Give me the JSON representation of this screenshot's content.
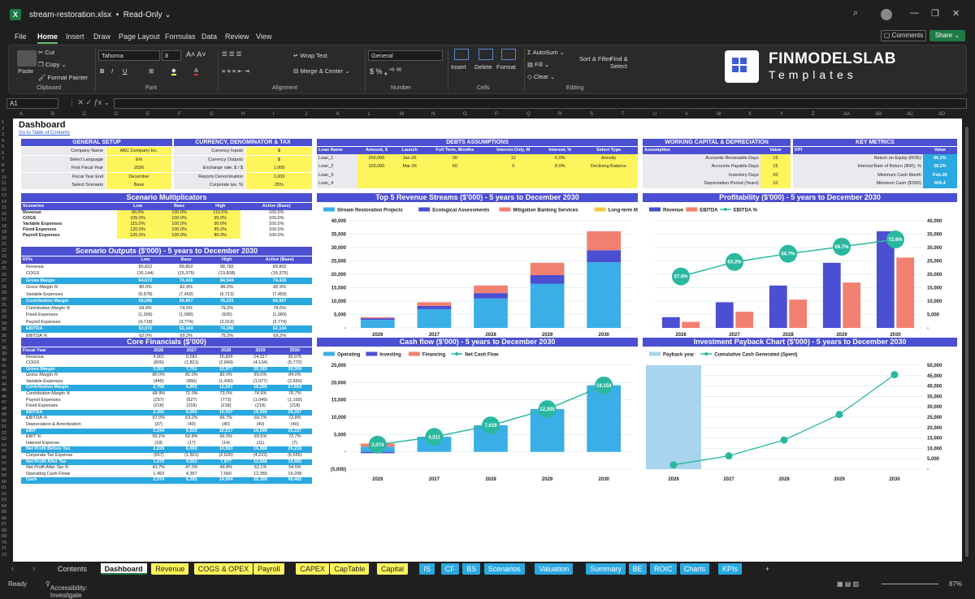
{
  "window": {
    "file": "stream-restoration.xlsx",
    "mode": "Read-Only"
  },
  "menu": [
    "File",
    "Home",
    "Insert",
    "Draw",
    "Page Layout",
    "Formulas",
    "Data",
    "Review",
    "View"
  ],
  "buttons": {
    "comments": "Comments",
    "share": "Share"
  },
  "ribbon": {
    "paste": "Paste",
    "cut": "Cut",
    "copy": "Copy",
    "format_painter": "Format Painter",
    "clipboard": "Clipboard",
    "font_name": "Tahoma",
    "font_size": "8",
    "font": "Font",
    "wrap": "Wrap Text",
    "merge": "Merge & Center",
    "alignment": "Alignment",
    "number_format": "General",
    "number": "Number",
    "insert": "Insert",
    "delete": "Delete",
    "format": "Format",
    "cells": "Cells",
    "autosum": "AutoSum",
    "fill": "Fill",
    "clear": "Clear",
    "sort": "Sort & Filter",
    "find": "Find & Select",
    "editing": "Editing"
  },
  "brand": {
    "line1": "FINMODELSLAB",
    "line2": "Templates"
  },
  "namebox": "A1",
  "sheet": {
    "title": "Dashboard",
    "link": "Go to Table of Contents"
  },
  "general": {
    "title": "GENERAL SETUP",
    "rows": [
      [
        "Company Name",
        "ABC Company Inc."
      ],
      [
        "Select Language",
        "EN"
      ],
      [
        "First Fiscal Year",
        "2026"
      ],
      [
        "Fiscal Year End",
        "December"
      ],
      [
        "Select Scenario",
        "Base"
      ]
    ]
  },
  "currency": {
    "title": "CURRENCY, DENOMINATOR & TAX",
    "rows": [
      [
        "Currency Inputs",
        "$"
      ],
      [
        "Currency Outputs",
        "$"
      ],
      [
        "Exchange rate, $ / $",
        "1.000"
      ],
      [
        "Reports Denomination",
        "1,000"
      ],
      [
        "Corporate tax, %",
        "25%"
      ]
    ]
  },
  "debts": {
    "title": "DEBTS ASSUMPTIONS",
    "headers": [
      "Loan Name",
      "Amount, $",
      "Launch",
      "Full Term, Months",
      "Interest-Only, M",
      "Interest, %",
      "Select Type"
    ],
    "rows": [
      [
        "Loan_1",
        "200,000",
        "Jan-26",
        "90",
        "12",
        "6.0%",
        "Annuity"
      ],
      [
        "Loan_2",
        "100,000",
        "Mar-26",
        "60",
        "0",
        "8.0%",
        "Declining Balance"
      ],
      [
        "Loan_3",
        "",
        "",
        "",
        "",
        "",
        ""
      ],
      [
        "Loan_4",
        "",
        "",
        "",
        "",
        "",
        ""
      ]
    ]
  },
  "wc": {
    "title": "WORKING CAPITAL & DEPRECIATION",
    "headers": [
      "Assumption",
      "Value"
    ],
    "rows": [
      [
        "Accounts Receivable Days",
        "15"
      ],
      [
        "Accounts Payable Days",
        "15"
      ],
      [
        "Inventory Days",
        "20"
      ],
      [
        "Depreciation Period (Years)",
        "10"
      ]
    ]
  },
  "kpi": {
    "title": "KEY METRICS",
    "headers": [
      "KPI",
      "Value"
    ],
    "rows": [
      [
        "Return on Equity (ROE)",
        "66.2%"
      ],
      [
        "Internal Rate of Return (IRR), %",
        "28.2%"
      ],
      [
        "Minimum Cash Month",
        "Feb-26"
      ],
      [
        "Minimum Cash ($'000)",
        "609.4"
      ]
    ]
  },
  "multipliers": {
    "title": "Scenario Multiplicators",
    "headers": [
      "Scenarios",
      "Low",
      "Base",
      "High",
      "Active (Base)"
    ],
    "rows": [
      [
        "Revenue",
        "90.0%",
        "100.0%",
        "110.0%",
        "100.0%"
      ],
      [
        "COGS",
        "105.0%",
        "100.0%",
        "95.0%",
        "100.0%"
      ],
      [
        "Variable Expenses",
        "115.0%",
        "100.0%",
        "90.0%",
        "100.0%"
      ],
      [
        "Fixed Expenses",
        "120.0%",
        "100.0%",
        "85.0%",
        "100.0%"
      ],
      [
        "Payroll Expenses",
        "125.0%",
        "100.0%",
        "80.0%",
        "100.0%"
      ]
    ]
  },
  "outputs": {
    "title": "Scenario Outputs ($'000) - 5 years to December 2030",
    "headers": [
      "KPIs",
      "Low",
      "Base",
      "High",
      "Active (Base)"
    ],
    "rows": [
      [
        "Revenue",
        "80,822",
        "89,802",
        "98,782",
        "89,802",
        ""
      ],
      [
        "COGS",
        "(16,144)",
        "(15,375)",
        "(13,838)",
        "(15,375)",
        ""
      ],
      [
        "Gross Margin",
        "64,672",
        "74,426",
        "84,944",
        "74,426",
        "hl"
      ],
      [
        "Gross Margin %",
        "80.0%",
        "82.9%",
        "86.0%",
        "82.9%",
        "it"
      ],
      [
        "Variable Expenses",
        "(9,578)",
        "(7,459)",
        "(6,713)",
        "(7,459)",
        ""
      ],
      [
        "Contribution Margin",
        "56,096",
        "66,967",
        "78,231",
        "66,967",
        "hl"
      ],
      [
        "Contribution Margin %",
        "69.4%",
        "74.6%",
        "79.2%",
        "74.6%",
        "it"
      ],
      [
        "Fixed Expenses",
        "(1,306)",
        "(1,089)",
        "(926)",
        "(1,089)",
        ""
      ],
      [
        "Payroll Expenses",
        "(4,718)",
        "(3,774)",
        "(3,019)",
        "(3,774)",
        ""
      ],
      [
        "EBITDA",
        "50,072",
        "62,104",
        "74,286",
        "62,104",
        "hl"
      ],
      [
        "EBITDA %",
        "62.0%",
        "69.2%",
        "75.2%",
        "69.2%",
        "it"
      ]
    ]
  },
  "core": {
    "title": "Core Financials ($'000)",
    "headers": [
      "Fiscal Year",
      "2026",
      "2027",
      "2028",
      "2029",
      "2030"
    ],
    "rows": [
      [
        "Revenue",
        "4,001",
        "9,582",
        "15,826",
        "24,317",
        "36,076",
        ""
      ],
      [
        "COGS",
        "(800)",
        "(1,821)",
        "(2,849)",
        "(4,134)",
        "(5,772)",
        ""
      ],
      [
        "Gross Margin",
        "3,201",
        "7,761",
        "12,977",
        "20,183",
        "30,304",
        "hl"
      ],
      [
        "Gross Margin %",
        "80.0%",
        "81.0%",
        "82.0%",
        "83.0%",
        "84.0%",
        "it"
      ],
      [
        "Variable Expenses",
        "(445)",
        "(956)",
        "(1,430)",
        "(1,977)",
        "(2,650)",
        ""
      ],
      [
        "Contribution Margin",
        "2,756",
        "6,805",
        "11,547",
        "18,205",
        "27,654",
        "hl"
      ],
      [
        "Contribution Margin %",
        "68.9%",
        "71.0%",
        "73.0%",
        "74.9%",
        "76.7%",
        "it"
      ],
      [
        "Payroll Expenses",
        "(257)",
        "(527)",
        "(773)",
        "(1,049)",
        "(1,169)",
        ""
      ],
      [
        "Fixed Expenses",
        "(218)",
        "(218)",
        "(218)",
        "(218)",
        "(218)",
        ""
      ],
      [
        "EBITDA",
        "2,281",
        "6,060",
        "10,557",
        "16,939",
        "26,267",
        "hl"
      ],
      [
        "EBITDA %",
        "57.0%",
        "63.2%",
        "66.7%",
        "69.7%",
        "72.8%",
        "it"
      ],
      [
        "Depreciation & Amortization",
        "(37)",
        "(40)",
        "(40)",
        "(40)",
        "(40)",
        ""
      ],
      [
        "EBIT",
        "2,244",
        "6,020",
        "10,517",
        "16,099",
        "26,227",
        "hl"
      ],
      [
        "EBIT %",
        "56.1%",
        "62.8%",
        "66.5%",
        "69.5%",
        "72.7%",
        "it"
      ],
      [
        "Interest Expense",
        "(18)",
        "(17)",
        "(14)",
        "(11)",
        "(7)",
        ""
      ],
      [
        "Net Profit Before Tax",
        "2,226",
        "6,003",
        "10,503",
        "16,888",
        "26,218",
        "hl"
      ],
      [
        "Corporate Tax Expense",
        "(557)",
        "(1,501)",
        "(2,626)",
        "(4,222)",
        "(6,555)",
        ""
      ],
      [
        "Net Profit After Tax",
        "1,670",
        "4,502",
        "7,877",
        "12,666",
        "19,665",
        "hl"
      ],
      [
        "Net Profit After Tax %",
        "41.7%",
        "47.0%",
        "49.8%",
        "52.1%",
        "54.5%",
        "it"
      ],
      [
        "Operating Cash Flows",
        "1,493",
        "4,357",
        "7,666",
        "12,355",
        "19,208",
        ""
      ],
      [
        "Cash",
        "2,074",
        "6,385",
        "14,004",
        "26,309",
        "45,462",
        "hl"
      ]
    ]
  },
  "charts": {
    "revenue": {
      "title": "Top 5 Revenue Streams ($'000) - 5 years to December 2030",
      "legend": [
        "Stream Restoration Projects",
        "Ecological Assessments",
        "Mitigation Banking Services",
        "Long-term Monitoring",
        "Other Revenue"
      ],
      "colors": [
        "#3aaee6",
        "#4b4fd1",
        "#f28070",
        "#f5c842",
        "#999999"
      ]
    },
    "profit": {
      "title": "Profitability ($'000) - 5 years to December 2030",
      "legend": [
        "Revenue",
        "EBITDA",
        "EBITDA %"
      ],
      "colors": [
        "#4b4fd1",
        "#f28070",
        "#2ab8a0"
      ]
    },
    "cash": {
      "title": "Cash flow ($'000) - 5 years to December 2030",
      "legend": [
        "Operating",
        "Investing",
        "Financing",
        "Net Cash Flow"
      ],
      "colors": [
        "#3aaee6",
        "#4b4fd1",
        "#f28070",
        "#2ab8a0"
      ]
    },
    "payback": {
      "title": "Investment Payback Chart ($'000) - 5 years to December 2030",
      "legend": [
        "Payback year",
        "Cumulative Cash Generated (Spent)"
      ],
      "colors": [
        "#a8d4ee",
        "#2ab8a0"
      ]
    }
  },
  "chart_data": [
    {
      "type": "bar",
      "title": "Top 5 Revenue Streams ($'000) - 5 years to December 2030",
      "categories": [
        "2026",
        "2027",
        "2028",
        "2029",
        "2030"
      ],
      "ylim": [
        0,
        40000
      ],
      "yticks": [
        "-",
        "5,000",
        "10,000",
        "15,000",
        "20,000",
        "25,000",
        "30,000",
        "35,000",
        "40,000"
      ],
      "series": [
        {
          "name": "Stream Restoration Projects",
          "values": [
            3000,
            7000,
            11000,
            16500,
            24500
          ]
        },
        {
          "name": "Ecological Assessments",
          "values": [
            600,
            1200,
            2000,
            3200,
            4500
          ]
        },
        {
          "name": "Mitigation Banking Services",
          "values": [
            400,
            1380,
            2826,
            4617,
            7076
          ]
        },
        {
          "name": "Long-term Monitoring",
          "values": [
            0,
            0,
            0,
            0,
            0
          ]
        },
        {
          "name": "Other Revenue",
          "values": [
            0,
            0,
            0,
            0,
            0
          ]
        }
      ]
    },
    {
      "type": "bar",
      "title": "Profitability ($'000) - 5 years to December 2030",
      "categories": [
        "2026",
        "2027",
        "2028",
        "2029",
        "2030"
      ],
      "ylim": [
        0,
        40000
      ],
      "yticks": [
        "-",
        "5,000",
        "10,000",
        "15,000",
        "20,000",
        "25,000",
        "30,000",
        "35,000",
        "40,000"
      ],
      "series": [
        {
          "name": "Revenue",
          "values": [
            4001,
            9582,
            15826,
            24317,
            36076
          ]
        },
        {
          "name": "EBITDA",
          "values": [
            2281,
            6060,
            10557,
            16939,
            26267
          ]
        },
        {
          "name": "EBITDA %",
          "values": [
            57.0,
            63.2,
            66.7,
            69.7,
            72.8
          ],
          "labels": [
            "57.0%",
            "63.2%",
            "66.7%",
            "69.7%",
            "72.8%"
          ]
        }
      ]
    },
    {
      "type": "bar",
      "title": "Cash flow ($'000) - 5 years to December 2030",
      "categories": [
        "2026",
        "2027",
        "2028",
        "2029",
        "2030"
      ],
      "ylim": [
        -5000,
        25000
      ],
      "yticks": [
        "(5,000)",
        "-",
        "5,000",
        "10,000",
        "15,000",
        "20,000",
        "25,000"
      ],
      "series": [
        {
          "name": "Operating",
          "values": [
            1493,
            4357,
            7666,
            12355,
            19208
          ]
        },
        {
          "name": "Investing",
          "values": [
            -400,
            0,
            0,
            0,
            0
          ]
        },
        {
          "name": "Financing",
          "values": [
            900,
            0,
            0,
            0,
            0
          ]
        },
        {
          "name": "Net Cash Flow",
          "values": [
            2074,
            4311,
            7619,
            12305,
            19153
          ],
          "labels": [
            "2,074",
            "4,311",
            "7,619",
            "12,305",
            "19,153"
          ]
        }
      ]
    },
    {
      "type": "line",
      "title": "Investment Payback Chart ($'000) - 5 years to December 2030",
      "categories": [
        "2026",
        "2027",
        "2028",
        "2029",
        "2030"
      ],
      "ylim": [
        0,
        50000
      ],
      "yticks": [
        "-",
        "5,000",
        "10,000",
        "15,000",
        "20,000",
        "25,000",
        "30,000",
        "35,000",
        "40,000",
        "45,000",
        "50,000"
      ],
      "series": [
        {
          "name": "Payback year",
          "values": [
            1,
            0,
            0,
            0,
            0
          ]
        },
        {
          "name": "Cumulative Cash Generated (Spent)",
          "values": [
            2074,
            6385,
            14004,
            26309,
            45462
          ]
        }
      ]
    }
  ],
  "tabs": [
    [
      "Contents",
      "#1f1f1f",
      "#ddd"
    ],
    [
      "Dashboard",
      "#ffffff",
      "#111"
    ],
    [
      "Revenue",
      "#fef45c",
      "#222"
    ],
    [
      "COGS & OPEX",
      "#fef45c",
      "#222"
    ],
    [
      "Payroll",
      "#fef45c",
      "#222"
    ],
    [
      "CAPEX",
      "#fef45c",
      "#222"
    ],
    [
      "CapTable",
      "#fef45c",
      "#222"
    ],
    [
      "Capital",
      "#fef45c",
      "#222"
    ],
    [
      "IS",
      "#2aa8e0",
      "#fff"
    ],
    [
      "CF",
      "#2aa8e0",
      "#fff"
    ],
    [
      "BS",
      "#2aa8e0",
      "#fff"
    ],
    [
      "Scenarios",
      "#2aa8e0",
      "#fff"
    ],
    [
      "Valuation",
      "#2aa8e0",
      "#fff"
    ],
    [
      "Summary",
      "#2aa8e0",
      "#fff"
    ],
    [
      "BE",
      "#2aa8e0",
      "#fff"
    ],
    [
      "ROIC",
      "#2aa8e0",
      "#fff"
    ],
    [
      "Charts",
      "#2aa8e0",
      "#fff"
    ],
    [
      "KPIs",
      "#2aa8e0",
      "#fff"
    ]
  ],
  "status": {
    "ready": "Ready",
    "accessibility": "Accessibility: Investigate",
    "zoom": "87%"
  }
}
